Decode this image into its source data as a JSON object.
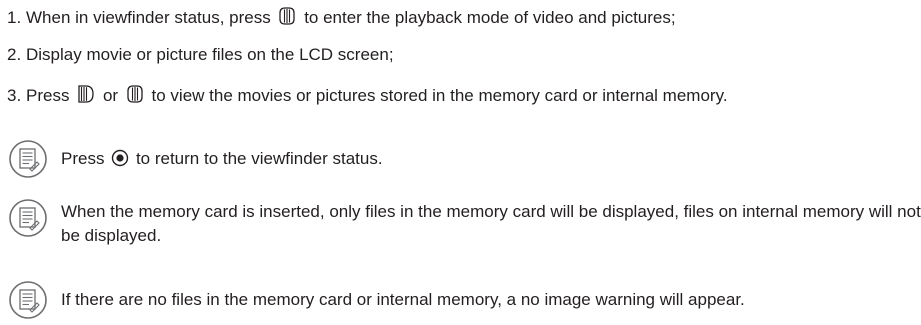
{
  "steps": [
    {
      "number": "1.",
      "text_before": "When in viewfinder status, press",
      "icon": "left-arrow-button-icon",
      "text_after": "to enter the playback mode of video and pictures;"
    },
    {
      "number": "2.",
      "text": "Display movie or picture files on the LCD screen;"
    },
    {
      "number": "3.",
      "text_before": "Press",
      "icon_1": "right-arrow-button-icon",
      "text_middle": "or",
      "icon_2": "left-arrow-button-icon",
      "text_after": "to view the movies or pictures stored in the memory card or internal memory."
    }
  ],
  "notes": [
    {
      "icon": "memo-note-icon",
      "text_before": "Press",
      "inline_icon": "shutter-button-icon",
      "text_after": "to return to the viewfinder status."
    },
    {
      "icon": "memo-note-icon",
      "text": "When the memory card is inserted, only files in the memory card will be displayed, files on internal memory will not be displayed."
    },
    {
      "icon": "memo-note-icon",
      "text": "If there are no files in the memory card or internal memory, a no image warning will appear."
    }
  ]
}
